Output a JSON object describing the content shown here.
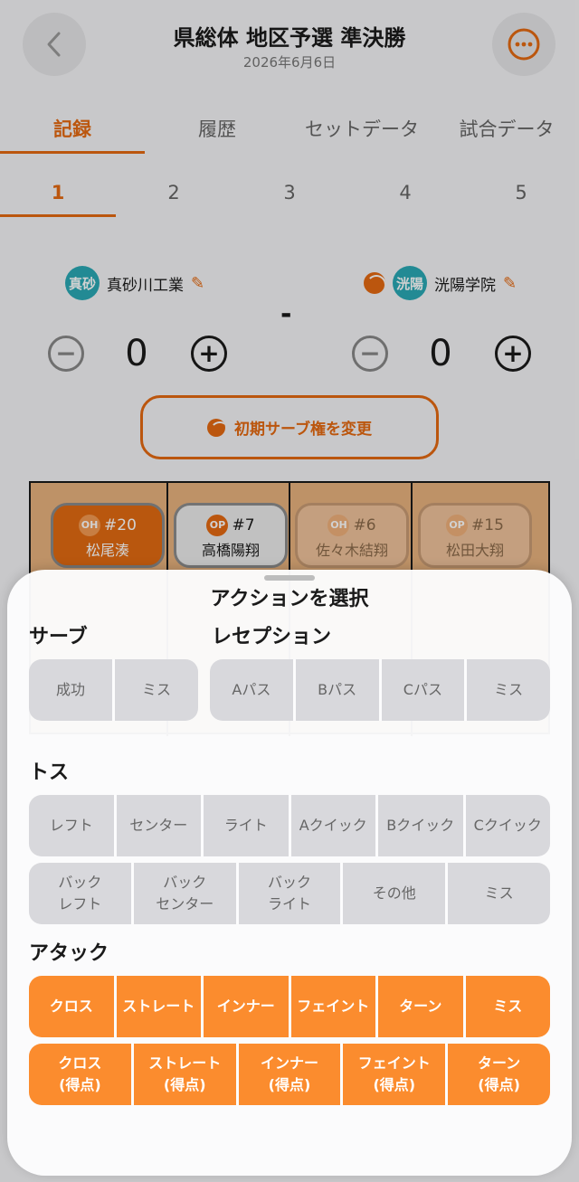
{
  "header": {
    "title": "県総体 地区予選 準決勝",
    "date": "2026年6月6日"
  },
  "tabs": [
    {
      "label": "記録",
      "active": true
    },
    {
      "label": "履歴",
      "active": false
    },
    {
      "label": "セットデータ",
      "active": false
    },
    {
      "label": "試合データ",
      "active": false
    }
  ],
  "sets": [
    "1",
    "2",
    "3",
    "4",
    "5"
  ],
  "active_set": "1",
  "teams": {
    "home": {
      "badge": "真砂",
      "name": "真砂川工業",
      "score": "0"
    },
    "away": {
      "badge": "洸陽",
      "name": "洸陽学院",
      "score": "0"
    },
    "separator": "-"
  },
  "serve_button": {
    "label": "初期サーブ権を変更"
  },
  "players": [
    {
      "pos": "OH",
      "number": "#20",
      "name": "松尾湊"
    },
    {
      "pos": "OP",
      "number": "#7",
      "name": "高橋陽翔"
    },
    {
      "pos": "OH",
      "number": "#6",
      "name": "佐々木結翔"
    },
    {
      "pos": "OP",
      "number": "#15",
      "name": "松田大翔"
    }
  ],
  "sheet": {
    "title": "アクションを選択",
    "serve": {
      "label": "サーブ",
      "buttons": [
        "成功",
        "ミス"
      ]
    },
    "reception": {
      "label": "レセプション",
      "buttons": [
        "Aパス",
        "Bパス",
        "Cパス",
        "ミス"
      ]
    },
    "toss": {
      "label": "トス",
      "row1": [
        "レフト",
        "センター",
        "ライト",
        "Aクイック",
        "Bクイック",
        "Cクイック"
      ],
      "row2": [
        "バック\nレフト",
        "バック\nセンター",
        "バック\nライト",
        "その他",
        "ミス"
      ]
    },
    "attack": {
      "label": "アタック",
      "row1": [
        "クロス",
        "ストレート",
        "インナー",
        "フェイント",
        "ターン",
        "ミス"
      ],
      "row2": [
        "クロス\n(得点)",
        "ストレート\n(得点)",
        "インナー\n(得点)",
        "フェイント\n(得点)",
        "ターン\n(得点)"
      ]
    }
  },
  "colors": {
    "accent": "#e56a12",
    "attack_button": "#fb8c2e",
    "team_badge": "#2aa9b5"
  }
}
